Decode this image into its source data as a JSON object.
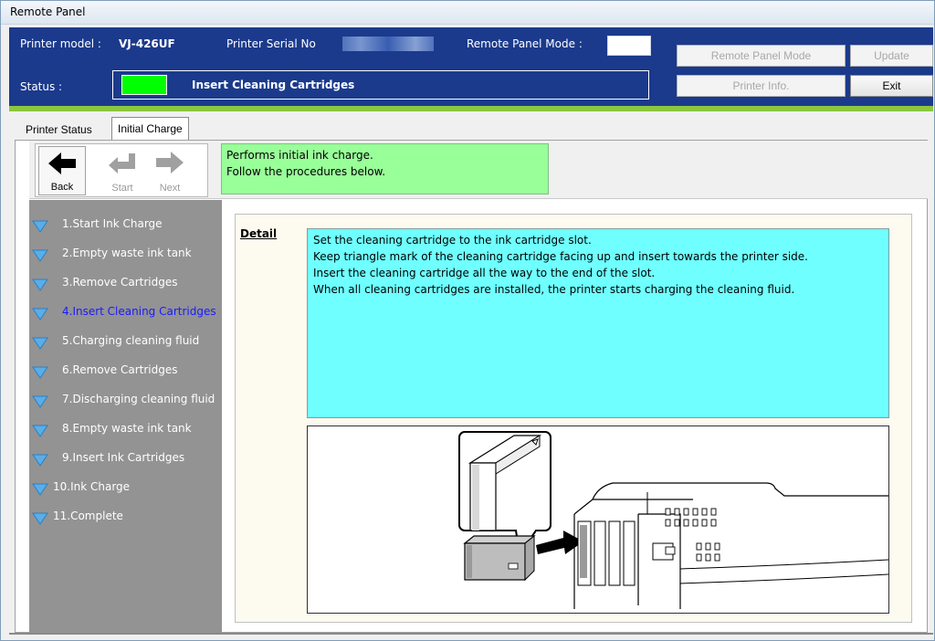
{
  "window": {
    "title": "Remote Panel"
  },
  "header": {
    "printer_model_label": "Printer model :",
    "printer_model_value": "VJ-426UF",
    "serial_label": "Printer Serial No",
    "remote_panel_mode_label": "Remote Panel Mode :",
    "status_label": "Status :",
    "status_value": "Insert Cleaning Cartridges",
    "status_color": "#00ff00",
    "header_bg": "#1b3a8c",
    "buttons": {
      "remote_panel_mode": "Remote Panel Mode",
      "update": "Update",
      "printer_info": "Printer Info.",
      "exit": "Exit"
    }
  },
  "tabs": [
    {
      "label": "Printer Status",
      "active": false
    },
    {
      "label": "Initial Charge",
      "active": true
    }
  ],
  "toolbar": {
    "back_label": "Back",
    "start_label": "Start",
    "next_label": "Next"
  },
  "info": {
    "line1": "Performs initial ink charge.",
    "line2": "Follow the procedures below."
  },
  "steps": [
    {
      "label": "1.Start Ink Charge",
      "current": false
    },
    {
      "label": "2.Empty waste ink tank",
      "current": false
    },
    {
      "label": "3.Remove Cartridges",
      "current": false
    },
    {
      "label": "4.Insert Cleaning Cartridges",
      "current": true
    },
    {
      "label": "5.Charging cleaning fluid",
      "current": false
    },
    {
      "label": "6.Remove Cartridges",
      "current": false
    },
    {
      "label": "7.Discharging cleaning fluid",
      "current": false
    },
    {
      "label": "8.Empty waste ink tank",
      "current": false
    },
    {
      "label": "9.Insert Ink Cartridges",
      "current": false
    },
    {
      "label": "10.Ink Charge",
      "current": false
    },
    {
      "label": "11.Complete",
      "current": false
    }
  ],
  "detail": {
    "label": "Detail",
    "lines": [
      "Set the cleaning cartridge to the ink cartridge slot.",
      "Keep triangle mark of the cleaning cartridge facing up and insert towards the printer side.",
      "Insert the cleaning cartridge all the way to the end of the slot.",
      "When all cleaning cartridges are installed, the printer starts charging the cleaning fluid."
    ]
  }
}
